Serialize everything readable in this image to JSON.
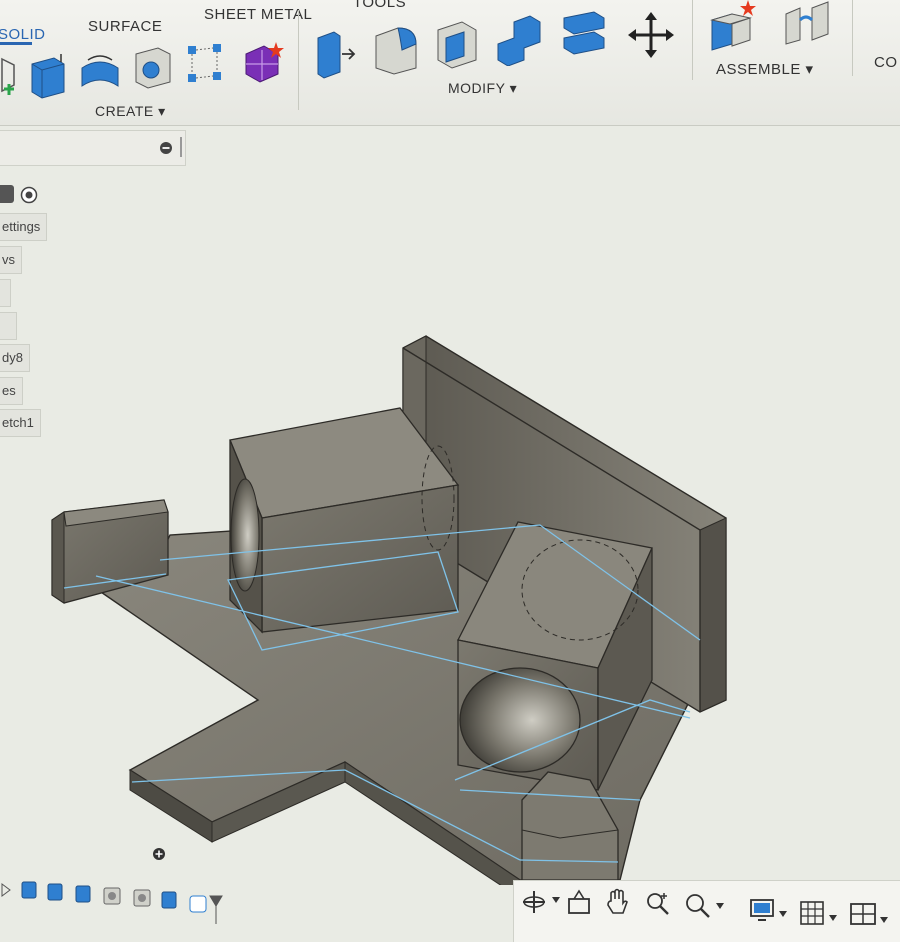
{
  "toolbar": {
    "tabs": [
      {
        "label": "SOLID",
        "active": true
      },
      {
        "label": "SURFACE",
        "active": false
      },
      {
        "label": "SHEET METAL",
        "active": false
      },
      {
        "label": "TOOLS",
        "active": false
      }
    ],
    "groups": {
      "create": "CREATE ▾",
      "modify": "MODIFY ▾",
      "assemble": "ASSEMBLE ▾",
      "construct": "CO"
    }
  },
  "browser": {
    "items": [
      "ettings",
      "vs",
      "dy8",
      "es",
      "etch1"
    ]
  },
  "colors": {
    "accent": "#2a66b2",
    "icon_blue": "#2f7fd0",
    "body_grey": "#77746a",
    "sketch_line": "#7fc2e8",
    "background": "#e9ebe4"
  }
}
